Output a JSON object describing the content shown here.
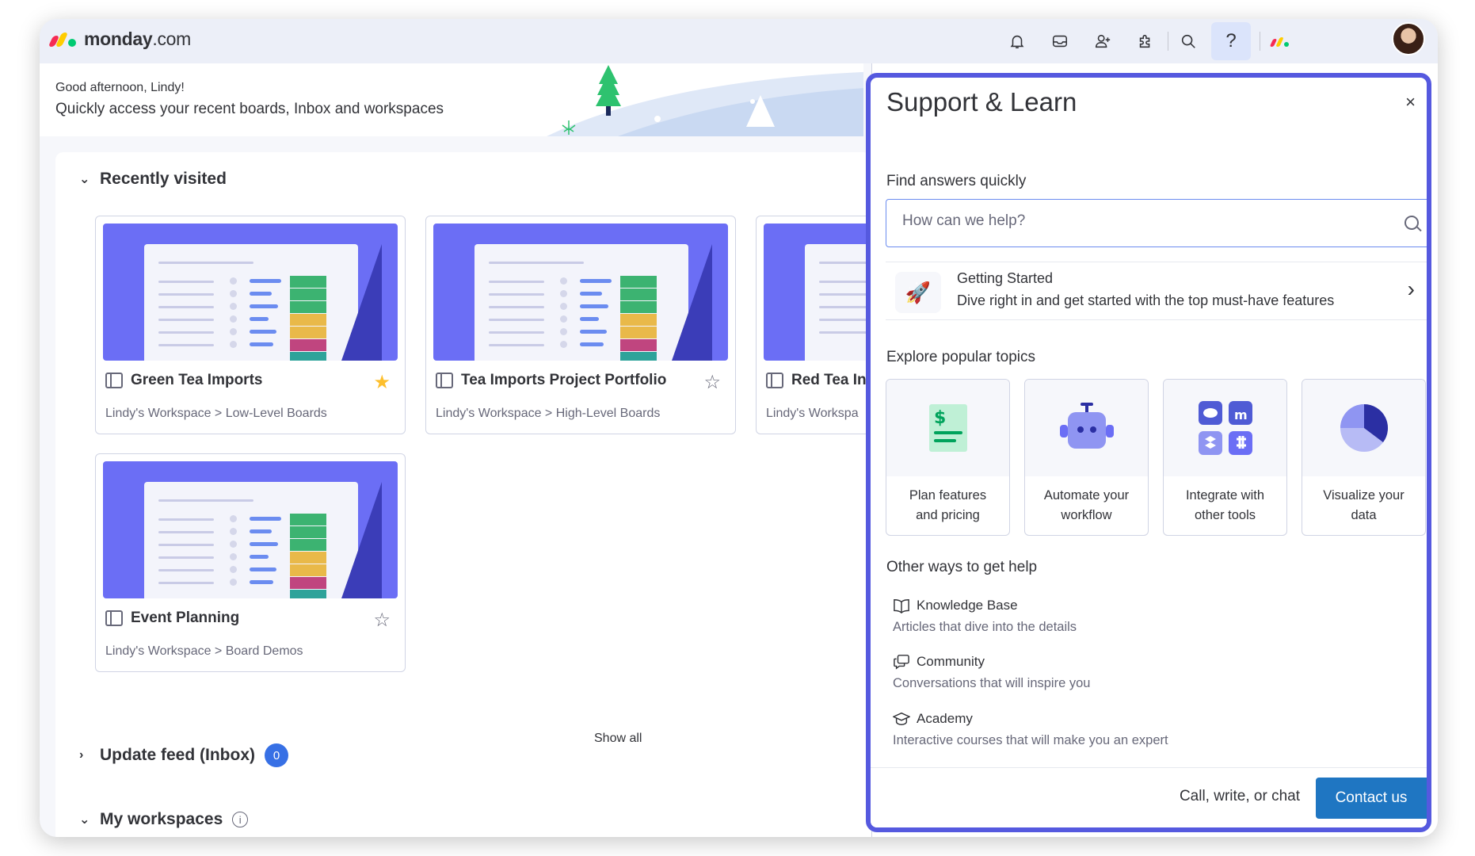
{
  "app": {
    "logo_text_bold": "monday",
    "logo_text_light": ".com"
  },
  "topbar": {
    "icons": [
      "bell-icon",
      "inbox-icon",
      "invite-members-icon",
      "apps-icon",
      "search-icon",
      "help-icon",
      "monday-logo-icon",
      "avatar"
    ],
    "help_glyph": "?"
  },
  "greeting": {
    "hello": "Good afternoon, Lindy!",
    "subtitle": "Quickly access your recent boards, Inbox and workspaces"
  },
  "recent": {
    "title": "Recently visited",
    "boards": [
      {
        "name": "Green Tea Imports",
        "path": "Lindy's Workspace > Low-Level Boards",
        "starred": true
      },
      {
        "name": "Tea Imports Project Portfolio",
        "path": "Lindy's Workspace > High-Level Boards",
        "starred": false
      },
      {
        "name": "Red Tea In",
        "path": "Lindy's Workspa",
        "starred": false
      },
      {
        "name": "Event Planning",
        "path": "Lindy's Workspace > Board Demos",
        "starred": false
      }
    ],
    "show_all": "Show all"
  },
  "update_feed": {
    "title": "Update feed (Inbox)",
    "count": "0"
  },
  "workspaces": {
    "title": "My workspaces",
    "info_glyph": "i"
  },
  "support": {
    "title": "Support & Learn",
    "close_glyph": "×",
    "find_label": "Find answers quickly",
    "search_placeholder": "How can we help?",
    "getting_started": {
      "title": "Getting Started",
      "desc": "Dive right in and get started with the top must-have features"
    },
    "explore_label": "Explore popular topics",
    "topics": [
      {
        "line1": "Plan features",
        "line2": "and pricing"
      },
      {
        "line1": "Automate your",
        "line2": "workflow"
      },
      {
        "line1": "Integrate with",
        "line2": "other tools"
      },
      {
        "line1": "Visualize your",
        "line2": "data"
      }
    ],
    "other_label": "Other ways to get help",
    "help_items": [
      {
        "title": "Knowledge Base",
        "desc": "Articles that dive into the details"
      },
      {
        "title": "Community",
        "desc": "Conversations that will inspire you"
      },
      {
        "title": "Academy",
        "desc": "Interactive courses that will make you an expert"
      }
    ],
    "footer_text": "Call, write, or chat",
    "contact_button": "Contact us"
  },
  "colors": {
    "accent": "#5559df",
    "primary_button": "#1f76c2",
    "thumb_purple": "#6b6ef5",
    "star_yellow": "#fdbf2d",
    "badge_blue": "#3770e5"
  }
}
